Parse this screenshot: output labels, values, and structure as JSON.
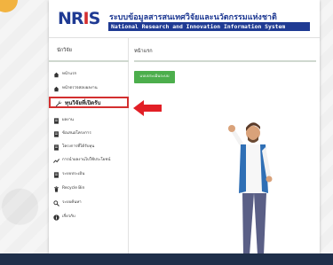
{
  "header": {
    "logo": {
      "letters": [
        "N",
        "R",
        "I",
        "S"
      ]
    },
    "title_th": "ระบบข้อมูลสารสนเทศวิจัยและนวัตกรรมแห่งชาติ",
    "title_en": "National Research and Innovation Information System"
  },
  "sidebar": {
    "heading": "นักวิจัย",
    "items": [
      {
        "label": "หน้าแรก",
        "icon": "home-icon"
      },
      {
        "label": "หน้าตรวจสอบผลงาน",
        "icon": "home-icon"
      },
      {
        "label": "ทุนวิจัยที่เปิดรับ",
        "icon": "wrench-icon",
        "highlighted": true
      },
      {
        "label": "ผลงาน",
        "icon": "document-icon"
      },
      {
        "label": "ข้อเสนอโครงการ",
        "icon": "document-icon"
      },
      {
        "label": "โครงการที่ได้รับทุน",
        "icon": "document-icon"
      },
      {
        "label": "การนำผลงานไปใช้ประโยชน์",
        "icon": "chart-line-icon"
      },
      {
        "label": "ระบบประเมิน",
        "icon": "document-icon"
      },
      {
        "label": "Recycle Bin",
        "icon": "trash-icon"
      },
      {
        "label": "ระบบค้นหา",
        "icon": "search-icon"
      },
      {
        "label": "เกี่ยวกับ",
        "icon": "info-icon"
      }
    ]
  },
  "main": {
    "title": "หน้าแรก",
    "action_button": "แบบประเมินระบบ"
  },
  "colors": {
    "brand_blue": "#1f3a93",
    "accent_red": "#d32f2f",
    "button_green": "#4cae4c"
  }
}
